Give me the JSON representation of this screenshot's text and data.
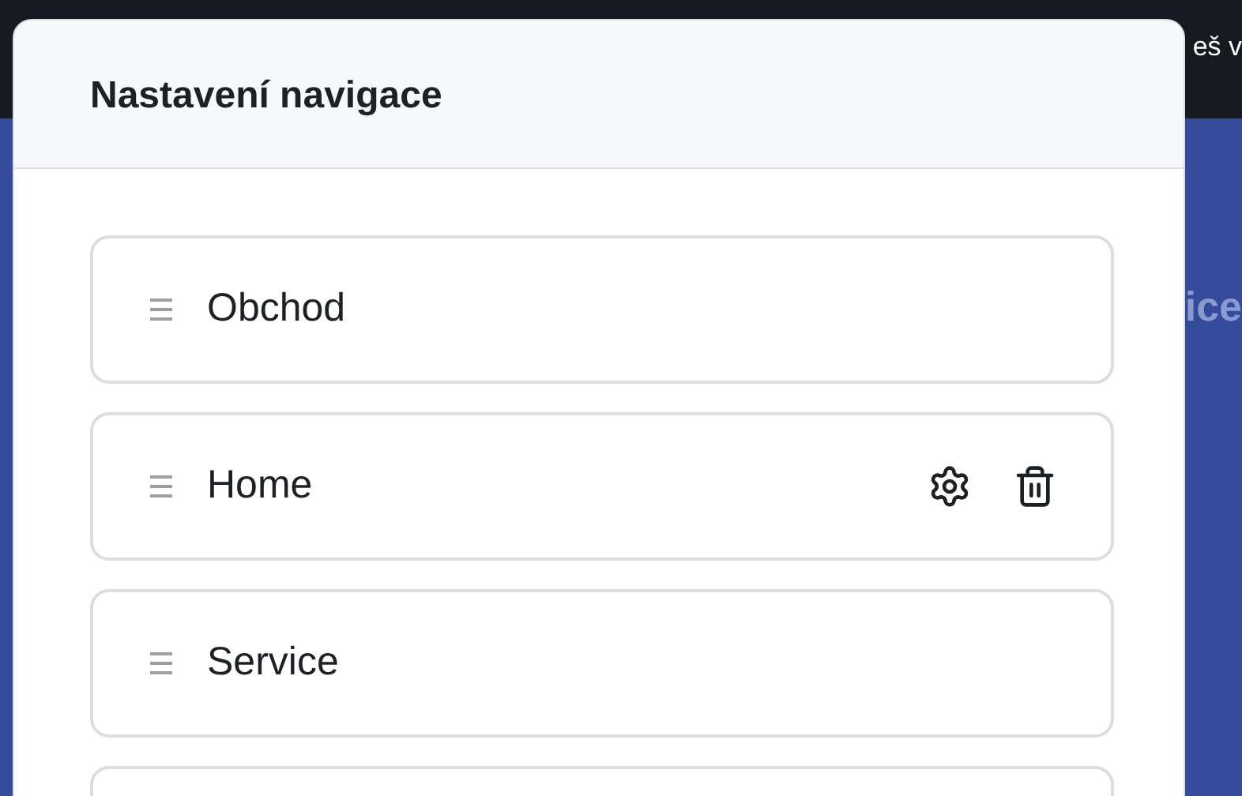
{
  "background": {
    "banner_fragment": "eš v",
    "page_fragment": "ice"
  },
  "dialog": {
    "title": "Nastavení navigace"
  },
  "items": [
    {
      "label": "Obchod",
      "show_actions": false
    },
    {
      "label": "Home",
      "show_actions": true
    },
    {
      "label": "Service",
      "show_actions": false
    }
  ]
}
